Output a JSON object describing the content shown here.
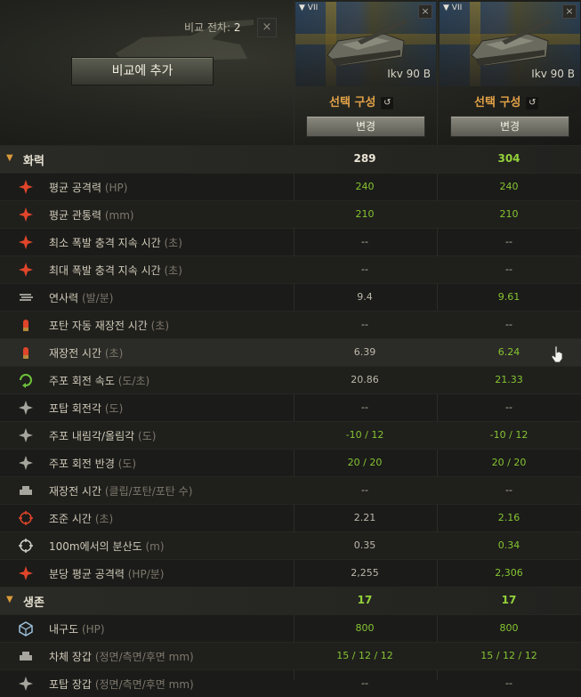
{
  "header": {
    "compare_label": "비교 전차:",
    "compare_count": "2",
    "clear_icon": "×",
    "add_button": "비교에 추가"
  },
  "tanks": [
    {
      "tier": "VII",
      "name": "Ikv 90 B",
      "config_label": "선택 구성",
      "config_icon": "↺",
      "change_button": "변경",
      "close_icon": "×"
    },
    {
      "tier": "VII",
      "name": "Ikv 90 B",
      "config_label": "선택 구성",
      "config_icon": "↺",
      "change_button": "변경",
      "close_icon": "×"
    }
  ],
  "rows": [
    {
      "type": "category",
      "label": "화력",
      "unit": "",
      "v1": "289",
      "v2": "304",
      "chevron": "▼"
    },
    {
      "icon": "damage-icon",
      "label": "평균 공격력",
      "unit": "(HP)",
      "v1": "240",
      "v2": "240"
    },
    {
      "icon": "penetration-icon",
      "label": "평균 관통력",
      "unit": "(mm)",
      "v1": "210",
      "v2": "210"
    },
    {
      "icon": "burst-min-icon",
      "label": "최소 폭발 충격 지속 시간",
      "unit": "(초)",
      "v1": "--",
      "v2": "--"
    },
    {
      "icon": "burst-max-icon",
      "label": "최대 폭발 충격 지속 시간",
      "unit": "(초)",
      "v1": "--",
      "v2": "--"
    },
    {
      "icon": "rate-of-fire-icon",
      "label": "연사력",
      "unit": "(발/분)",
      "v1": "9.4",
      "v2": "9.61"
    },
    {
      "icon": "autoreload-icon",
      "label": "포탄 자동 재장전 시간",
      "unit": "(초)",
      "v1": "--",
      "v2": "--"
    },
    {
      "icon": "reload-icon",
      "label": "재장전 시간",
      "unit": "(초)",
      "v1": "6.39",
      "v2": "6.24"
    },
    {
      "icon": "traverse-icon",
      "label": "주포 회전 속도",
      "unit": "(도/초)",
      "v1": "20.86",
      "v2": "21.33"
    },
    {
      "icon": "turret-angle-icon",
      "label": "포탑 회전각",
      "unit": "(도)",
      "v1": "--",
      "v2": "--"
    },
    {
      "icon": "elevation-icon",
      "label": "주포 내림각/올림각",
      "unit": "(도)",
      "v1": "-10 / 12",
      "v2": "-10 / 12"
    },
    {
      "icon": "gun-arc-icon",
      "label": "주포 회전 반경",
      "unit": "(도)",
      "v1": "20 / 20",
      "v2": "20 / 20"
    },
    {
      "icon": "clip-reload-icon",
      "label": "재장전 시간",
      "unit": "(클립/포탄/포탄 수)",
      "v1": "--",
      "v2": "--"
    },
    {
      "icon": "aim-time-icon",
      "label": "조준 시간",
      "unit": "(초)",
      "v1": "2.21",
      "v2": "2.16"
    },
    {
      "icon": "dispersion-icon",
      "label": "100m에서의 분산도",
      "unit": "(m)",
      "v1": "0.35",
      "v2": "0.34"
    },
    {
      "icon": "dpm-icon",
      "label": "분당 평균 공격력",
      "unit": "(HP/분)",
      "v1": "2,255",
      "v2": "2,306"
    },
    {
      "type": "category",
      "label": "생존",
      "unit": "",
      "v1": "17",
      "v2": "17",
      "chevron": "▼"
    },
    {
      "icon": "hitpoints-icon",
      "label": "내구도",
      "unit": "(HP)",
      "v1": "800",
      "v2": "800"
    },
    {
      "icon": "hull-armor-icon",
      "label": "차체 장갑",
      "unit": "(정면/측면/후면 mm)",
      "v1": "15 / 12 / 12",
      "v2": "15 / 12 / 12"
    },
    {
      "icon": "turret-armor-icon",
      "label": "포탑 장갑",
      "unit": "(정면/측면/후면 mm)",
      "v1": "--",
      "v2": "--"
    }
  ],
  "colors": {
    "better": "#86c532",
    "config": "#e3a248"
  }
}
